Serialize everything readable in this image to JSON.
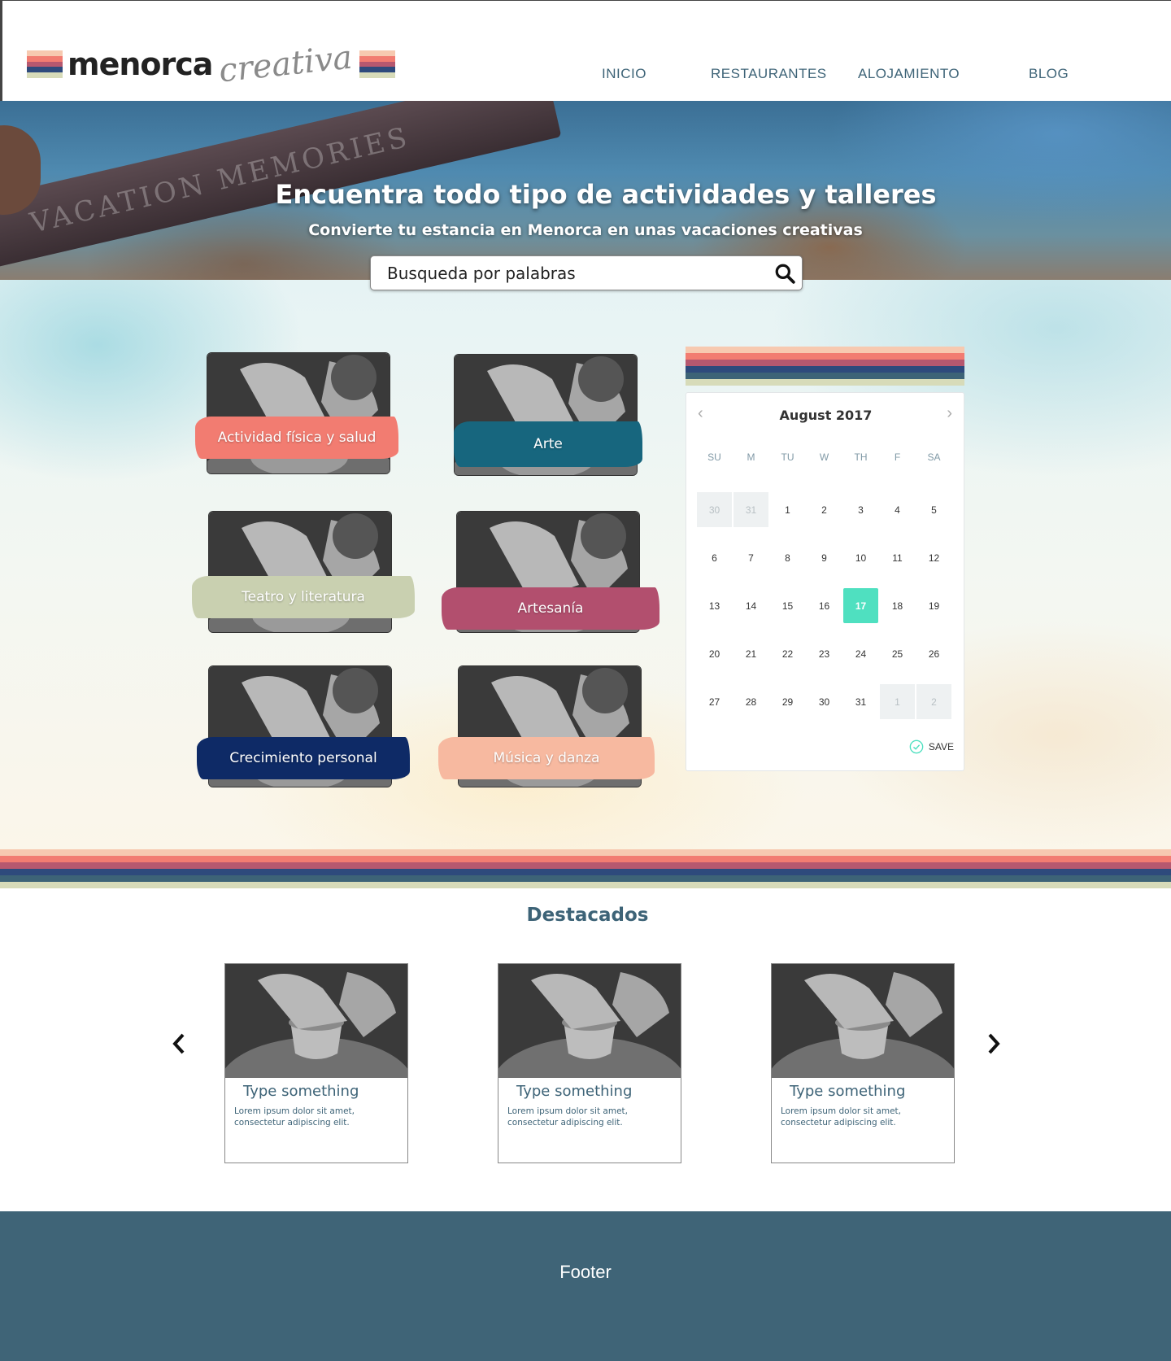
{
  "brand": {
    "name": "menorca",
    "script": "creativa",
    "stripe_colors": [
      "#f7c9b0",
      "#f27c71",
      "#b6586f",
      "#2e4a7c",
      "#d7dbb9"
    ]
  },
  "nav": {
    "items": [
      {
        "label": "INICIO"
      },
      {
        "label": "RESTAURANTES"
      },
      {
        "label": "ALOJAMIENTO"
      },
      {
        "label": "BLOG"
      }
    ]
  },
  "hero": {
    "banner_text": "VACATION MEMORIES",
    "title": "Encuentra todo tipo de actividades y talleres",
    "subtitle": "Convierte tu estancia en Menorca en unas vacaciones creativas"
  },
  "search": {
    "placeholder": "Busqueda por palabras",
    "value": ""
  },
  "categories": [
    {
      "label": "Actividad física y salud",
      "color": "#f27c71"
    },
    {
      "label": "Arte",
      "color": "#17667e"
    },
    {
      "label": "Teatro y literatura",
      "color": "#c9d0b0"
    },
    {
      "label": "Artesanía",
      "color": "#b24f6e"
    },
    {
      "label": "Crecimiento personal",
      "color": "#0e2a66"
    },
    {
      "label": "Música y danza",
      "color": "#f7b9a0"
    }
  ],
  "calendar": {
    "title": "August 2017",
    "weekdays": [
      "SU",
      "M",
      "TU",
      "W",
      "TH",
      "F",
      "SA"
    ],
    "days": [
      {
        "n": "30",
        "muted": true
      },
      {
        "n": "31",
        "muted": true
      },
      {
        "n": "1"
      },
      {
        "n": "2"
      },
      {
        "n": "3"
      },
      {
        "n": "4"
      },
      {
        "n": "5"
      },
      {
        "n": "6"
      },
      {
        "n": "7"
      },
      {
        "n": "8"
      },
      {
        "n": "9"
      },
      {
        "n": "10"
      },
      {
        "n": "11"
      },
      {
        "n": "12"
      },
      {
        "n": "13"
      },
      {
        "n": "14"
      },
      {
        "n": "15"
      },
      {
        "n": "16"
      },
      {
        "n": "17",
        "selected": true
      },
      {
        "n": "18"
      },
      {
        "n": "19"
      },
      {
        "n": "20"
      },
      {
        "n": "21"
      },
      {
        "n": "22"
      },
      {
        "n": "23"
      },
      {
        "n": "24"
      },
      {
        "n": "25"
      },
      {
        "n": "26"
      },
      {
        "n": "27"
      },
      {
        "n": "28"
      },
      {
        "n": "29"
      },
      {
        "n": "30"
      },
      {
        "n": "31"
      },
      {
        "n": "1",
        "muted": true
      },
      {
        "n": "2",
        "muted": true
      }
    ],
    "save_label": "SAVE",
    "accent": "#4fe0c0"
  },
  "featured": {
    "title": "Destacados",
    "cards": [
      {
        "title": "Type something",
        "text": "Lorem ipsum dolor sit amet, consectetur adipiscing elit."
      },
      {
        "title": "Type something",
        "text": "Lorem ipsum dolor sit amet, consectetur adipiscing elit."
      },
      {
        "title": "Type something",
        "text": "Lorem ipsum dolor sit amet, consectetur adipiscing elit."
      }
    ]
  },
  "footer": {
    "text": "Footer",
    "color": "#3f6477"
  }
}
